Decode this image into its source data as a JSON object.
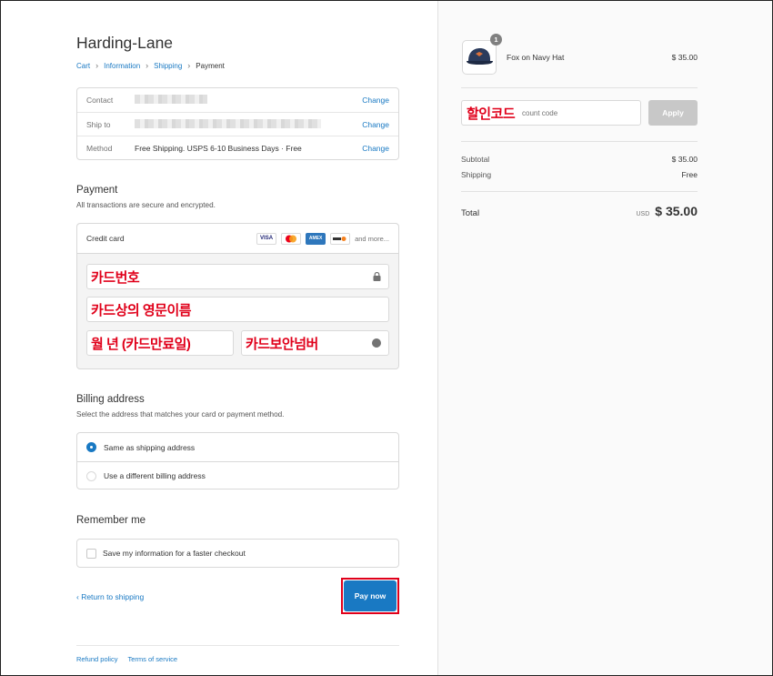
{
  "shop": {
    "title": "Harding-Lane"
  },
  "breadcrumb": {
    "cart": "Cart",
    "information": "Information",
    "shipping": "Shipping",
    "payment": "Payment"
  },
  "review": {
    "contact_label": "Contact",
    "ship_to_label": "Ship to",
    "method_label": "Method",
    "method_value": "Free Shipping. USPS 6-10 Business Days · Free",
    "change": "Change"
  },
  "payment": {
    "title": "Payment",
    "subtitle": "All transactions are secure and encrypted.",
    "credit_card_label": "Credit card",
    "brands": [
      "VISA",
      "AMEX"
    ],
    "more": "and more...",
    "card_number_annotation": "카드번호",
    "name_annotation": "카드상의 영문이름",
    "expiry_annotation": "월 년 (카드만료일)",
    "cvv_annotation": "카드보안넘버"
  },
  "billing": {
    "title": "Billing address",
    "subtitle": "Select the address that matches your card or payment method.",
    "option_same": "Same as shipping address",
    "option_different": "Use a different billing address"
  },
  "remember": {
    "title": "Remember me",
    "checkbox_label": "Save my information for a faster checkout"
  },
  "actions": {
    "return": "‹ Return to shipping",
    "pay": "Pay now"
  },
  "footer": {
    "refund": "Refund policy",
    "terms": "Terms of service"
  },
  "order": {
    "quantity": "1",
    "product_name": "Fox on Navy Hat",
    "product_price": "$ 35.00",
    "discount_annotation": "할인코드",
    "discount_placeholder": "count code",
    "apply": "Apply",
    "subtotal_label": "Subtotal",
    "subtotal_value": "$ 35.00",
    "shipping_label": "Shipping",
    "shipping_value": "Free",
    "total_label": "Total",
    "currency": "USD",
    "total_value": "$ 35.00"
  },
  "colors": {
    "accent": "#1979c3",
    "annotation": "#e0001a"
  }
}
